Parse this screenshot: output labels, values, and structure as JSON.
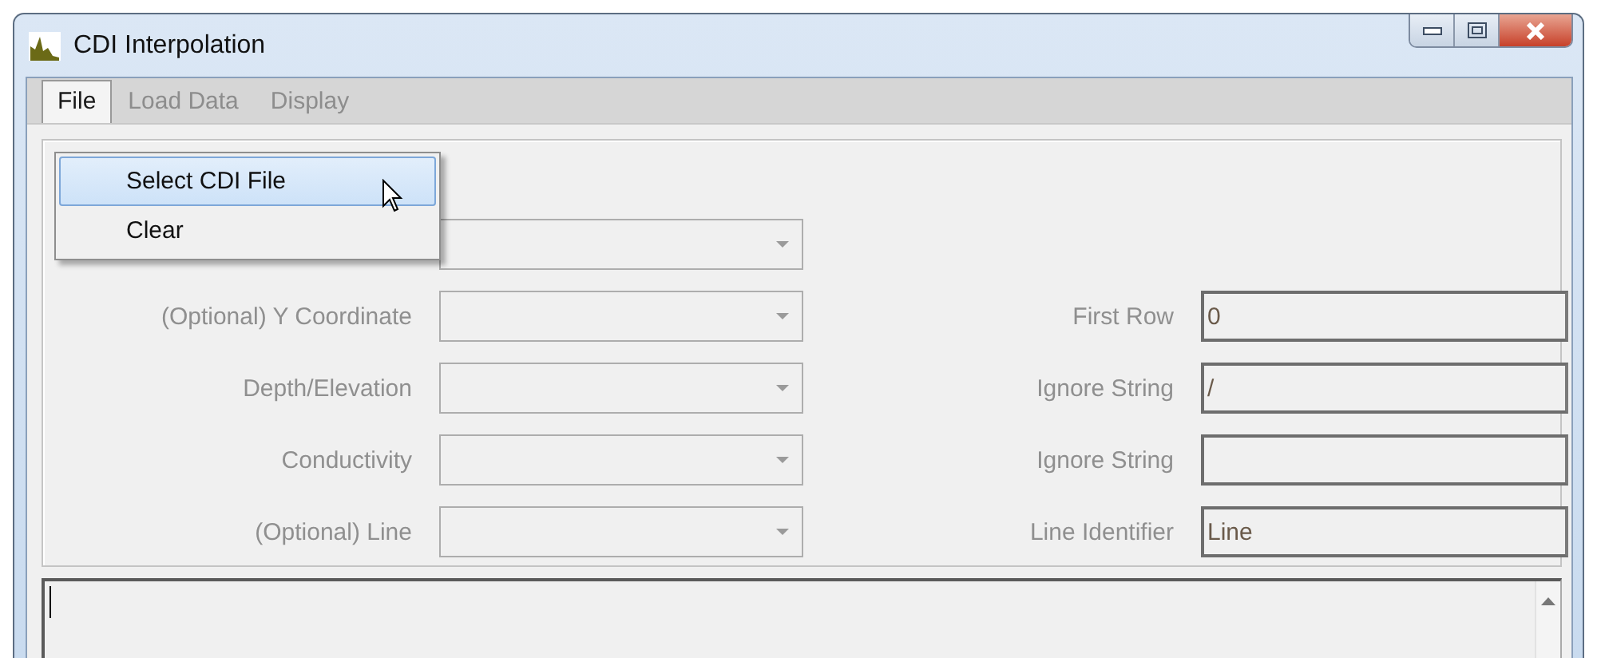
{
  "window": {
    "title": "CDI Interpolation"
  },
  "menu_bar": [
    {
      "label": "File",
      "selected": true,
      "disabled": false
    },
    {
      "label": "Load Data",
      "selected": false,
      "disabled": true
    },
    {
      "label": "Display",
      "selected": false,
      "disabled": true
    }
  ],
  "file_menu": [
    {
      "label": "Select CDI File",
      "selected": true
    },
    {
      "label": "Clear",
      "selected": false
    }
  ],
  "left_fields": [
    {
      "disabled": true
    },
    {
      "label": "(Optional) Y Coordinate",
      "disabled": true
    },
    {
      "label": "Depth/Elevation",
      "disabled": true
    },
    {
      "label": "Conductivity",
      "disabled": true
    },
    {
      "label": "(Optional) Line",
      "disabled": true
    }
  ],
  "right_fields": [
    {
      "label": "First Row",
      "value": "0"
    },
    {
      "label": "Ignore String",
      "value": "/"
    },
    {
      "label": "Ignore String"
    },
    {
      "label": "Line Identifier",
      "value": "Line"
    }
  ]
}
